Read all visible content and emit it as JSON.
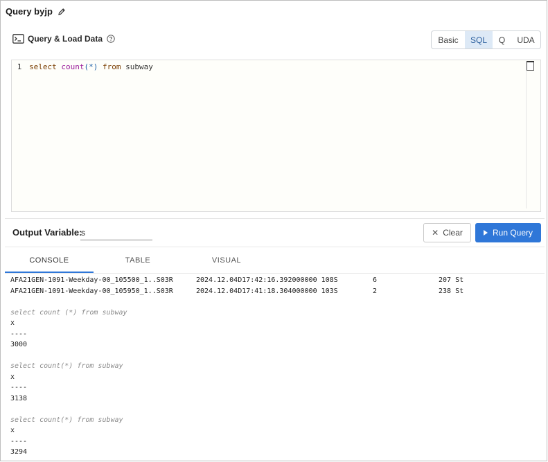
{
  "title": "Query byjp",
  "section": {
    "label": "Query & Load Data"
  },
  "modes": [
    "Basic",
    "SQL",
    "Q",
    "UDA"
  ],
  "active_mode": "SQL",
  "editor": {
    "line_number": "1",
    "tokens": {
      "select": "select",
      "count": "count",
      "args": "(*)",
      "from": "from",
      "table": "subway"
    }
  },
  "output_variable": {
    "label": "Output Variable:",
    "value": "s"
  },
  "buttons": {
    "clear": "Clear",
    "run": "Run Query"
  },
  "tabs": [
    "CONSOLE",
    "TABLE",
    "VISUAL"
  ],
  "active_tab": "CONSOLE",
  "console": {
    "rows": [
      [
        "AFA21GEN-1091-Weekday-00_105500_1..S03R",
        "2024.12.04D17:42:16.392000000 108S",
        "6",
        "207 St"
      ],
      [
        "AFA21GEN-1091-Weekday-00_105950_1..S03R",
        "2024.12.04D17:41:18.304000000 103S",
        "2",
        "238 St"
      ]
    ],
    "results": [
      {
        "query": "select count (*) from subway",
        "col": "x",
        "sep": "----",
        "value": "3000"
      },
      {
        "query": "select count(*) from subway",
        "col": "x",
        "sep": "----",
        "value": "3138"
      },
      {
        "query": "select count(*) from subway",
        "col": "x",
        "sep": "----",
        "value": "3294"
      }
    ]
  },
  "colors": {
    "accent": "#2f77d8",
    "active_segment": "#dde9f6"
  }
}
